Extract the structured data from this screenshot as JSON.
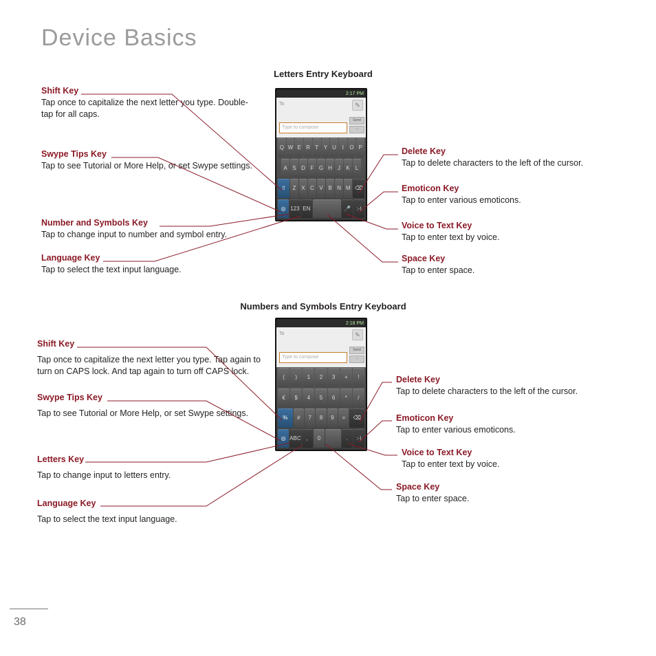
{
  "page": {
    "title": "Device Basics",
    "number": "38"
  },
  "section1": {
    "title": "Letters Entry Keyboard",
    "phone": {
      "time": "2:17 PM",
      "to_label": "To",
      "compose_placeholder": "Type to compose",
      "btn_send": "Send",
      "btn_attach": "⎘",
      "row1": [
        "Q",
        "W",
        "E",
        "R",
        "T",
        "Y",
        "U",
        "I",
        "O",
        "P"
      ],
      "row2": [
        "A",
        "S",
        "D",
        "F",
        "G",
        "H",
        "J",
        "K",
        "L"
      ],
      "row3_shift": "⇧",
      "row3": [
        "Z",
        "X",
        "C",
        "V",
        "B",
        "N",
        "M"
      ],
      "row3_del": "⌫",
      "row4_swype": "◎",
      "row4_num": "123",
      "row4_lang": "EN",
      "row4_space": " ",
      "row4_voice": "🎤",
      "row4_emot": ":-)"
    },
    "left": [
      {
        "title": "Shift Key",
        "desc": "Tap once to capitalize the next letter you type. Double-tap for all caps."
      },
      {
        "title": "Swype Tips Key",
        "desc": "Tap to see Tutorial or More Help, or set Swype settings."
      },
      {
        "title": "Number and Symbols Key",
        "desc": "Tap to change input to number and symbol entry."
      },
      {
        "title": "Language Key",
        "desc": "Tap to select the text input language."
      }
    ],
    "right": [
      {
        "title": "Delete Key",
        "desc": "Tap to delete characters to the left of the cursor."
      },
      {
        "title": "Emoticon Key",
        "desc": "Tap to enter various emoticons."
      },
      {
        "title": "Voice to Text Key",
        "desc": "Tap to enter text by voice."
      },
      {
        "title": "Space Key",
        "desc": "Tap to enter space."
      }
    ]
  },
  "section2": {
    "title": "Numbers and Symbols Entry Keyboard",
    "phone": {
      "time": "2:18 PM",
      "to_label": "To",
      "compose_placeholder": "Type to compose",
      "btn_send": "Send",
      "row1": [
        "(",
        ")",
        "1",
        "2",
        "3",
        "+",
        "!"
      ],
      "row2": [
        "€",
        "$",
        "4",
        "5",
        "6",
        "*",
        "/"
      ],
      "row3_shift": "%",
      "row3": [
        "#",
        "7",
        "8",
        "9",
        "="
      ],
      "row3_del": "⌫",
      "row4_swype": "◎",
      "row4_abc": "ABC",
      "row4_lang": ",",
      "row4_zero": "0",
      "row4_space": " ",
      "row4_voice": ".",
      "row4_emot": ":-)"
    },
    "left": [
      {
        "title": "Shift Key",
        "desc": "Tap once to capitalize the next letter you type. Tap again to turn on CAPS lock. And tap again to turn off CAPS lock."
      },
      {
        "title": "Swype Tips Key",
        "desc": "Tap to see Tutorial or More Help, or set Swype settings."
      },
      {
        "title": "Letters Key",
        "desc": "Tap to change input to letters entry."
      },
      {
        "title": "Language Key",
        "desc": "Tap to select the text input language."
      }
    ],
    "right": [
      {
        "title": "Delete Key",
        "desc": "Tap to delete characters to the left of the cursor."
      },
      {
        "title": "Emoticon Key",
        "desc": "Tap to enter various emoticons."
      },
      {
        "title": "Voice to Text Key",
        "desc": "Tap to enter text by voice."
      },
      {
        "title": "Space Key",
        "desc": "Tap to enter space."
      }
    ]
  }
}
